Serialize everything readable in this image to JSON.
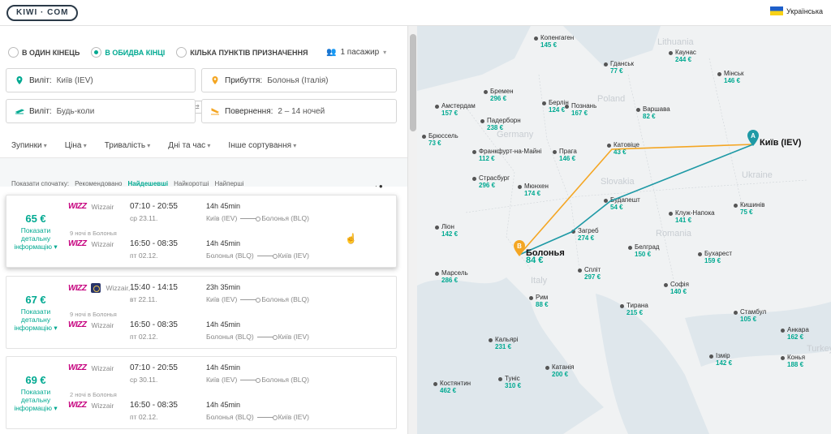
{
  "header": {
    "logo": "KIWI · COM",
    "language": "Українська"
  },
  "trip_type": {
    "one_way": "В ОДИН КІНЕЦЬ",
    "return": "В ОБИДВА КІНЦІ",
    "multi": "КІЛЬКА ПУНКТІВ ПРИЗНАЧЕННЯ",
    "selected": "return"
  },
  "passengers": "1 пасажир",
  "search": {
    "from_label": "Виліт:",
    "from_value": "Київ (IEV)",
    "to_label": "Прибуття:",
    "to_value": "Болонья (Італія)",
    "depart_label": "Виліт:",
    "depart_value": "Будь-коли",
    "return_label": "Повернення:",
    "return_value": "2 – 14 ночей"
  },
  "filters": [
    "Зупинки",
    "Ціна",
    "Тривалість",
    "Дні та час",
    "Інше сортування"
  ],
  "sort": {
    "label": "Показати спочатку:",
    "options": [
      "Рекомендовано",
      "Найдешевші",
      "Найкоротші",
      "Найперші"
    ],
    "active": "Найдешевші"
  },
  "results": [
    {
      "price": "65 €",
      "more": [
        "Показати",
        "детальну",
        "інформацію ▾"
      ],
      "nights": "9 ночі в Болонья",
      "out": {
        "airline": "Wizzair",
        "logo": "WIZZ",
        "times": "07:10 - 20:55",
        "date": "ср 23.11.",
        "duration": "14h 45min",
        "from": "Київ (IEV)",
        "to": "Болонья (BLQ)"
      },
      "back": {
        "airline": "Wizzair",
        "logo": "WIZZ",
        "times": "16:50 - 08:35",
        "date": "пт 02.12.",
        "duration": "14h 45min",
        "from": "Болонья (BLQ)",
        "to": "Київ (IEV)"
      }
    },
    {
      "price": "67 €",
      "more": [
        "Показати",
        "детальну",
        "інформацію ▾"
      ],
      "nights": "9 ночі в Болонья",
      "out": {
        "airline": "Wizzair, ...",
        "logo": "WIZZ",
        "times": "15:40 - 14:15",
        "date": "вт 22.11.",
        "duration": "23h 35min",
        "from": "Київ (IEV)",
        "to": "Болонья (BLQ)"
      },
      "back": {
        "airline": "Wizzair",
        "logo": "WIZZ",
        "times": "16:50 - 08:35",
        "date": "пт 02.12.",
        "duration": "14h 45min",
        "from": "Болонья (BLQ)",
        "to": "Київ (IEV)"
      }
    },
    {
      "price": "69 €",
      "more": [
        "Показати",
        "детальну",
        "інформацію ▾"
      ],
      "nights": "2 ночі в Болонья",
      "out": {
        "airline": "Wizzair",
        "logo": "WIZZ",
        "times": "07:10 - 20:55",
        "date": "ср 30.11.",
        "duration": "14h 45min",
        "from": "Київ (IEV)",
        "to": "Болонья (BLQ)"
      },
      "back": {
        "airline": "Wizzair",
        "logo": "WIZZ",
        "times": "16:50 - 08:35",
        "date": "пт 02.12.",
        "duration": "14h 45min",
        "from": "Болонья (BLQ)",
        "to": "Київ (IEV)"
      }
    }
  ],
  "map": {
    "origin": {
      "name": "Київ (IEV)",
      "marker": "A"
    },
    "destination": {
      "name": "Болонья",
      "price": "84 €",
      "marker": "B"
    },
    "countries": [
      "Lithuania",
      "Poland",
      "Germany",
      "Ukraine",
      "Slovakia",
      "Romania",
      "Italy",
      "Turkey"
    ],
    "cities": [
      {
        "name": "Копенгаген",
        "price": "145 €"
      },
      {
        "name": "Каунас",
        "price": "244 €"
      },
      {
        "name": "Гданськ",
        "price": "77 €"
      },
      {
        "name": "Мінськ",
        "price": "146 €"
      },
      {
        "name": "Бремен",
        "price": "296 €"
      },
      {
        "name": "Амстердам",
        "price": "157 €"
      },
      {
        "name": "Берлін",
        "price": "124 €"
      },
      {
        "name": "Познань",
        "price": "167 €"
      },
      {
        "name": "Варшава",
        "price": "82 €"
      },
      {
        "name": "Падерборн",
        "price": "238 €"
      },
      {
        "name": "Брюссель",
        "price": "73 €"
      },
      {
        "name": "Франкфурт-на-Майні",
        "price": "112 €"
      },
      {
        "name": "Прага",
        "price": "146 €"
      },
      {
        "name": "Катовіце",
        "price": "43 €"
      },
      {
        "name": "Страсбург",
        "price": "296 €"
      },
      {
        "name": "Мюнхен",
        "price": "174 €"
      },
      {
        "name": "Будапешт",
        "price": "54 €"
      },
      {
        "name": "Кишинів",
        "price": "75 €"
      },
      {
        "name": "Ліон",
        "price": "142 €"
      },
      {
        "name": "Клуж-Напока",
        "price": "141 €"
      },
      {
        "name": "Загреб",
        "price": "274 €"
      },
      {
        "name": "Белград",
        "price": "150 €"
      },
      {
        "name": "Бухарест",
        "price": "159 €"
      },
      {
        "name": "Марсель",
        "price": "286 €"
      },
      {
        "name": "Спліт",
        "price": "297 €"
      },
      {
        "name": "Софія",
        "price": "140 €"
      },
      {
        "name": "Рим",
        "price": "88 €"
      },
      {
        "name": "Тирана",
        "price": "215 €"
      },
      {
        "name": "Стамбул",
        "price": "105 €"
      },
      {
        "name": "Анкара",
        "price": "162 €"
      },
      {
        "name": "Кальярі",
        "price": "231 €"
      },
      {
        "name": "Ізмір",
        "price": "142 €"
      },
      {
        "name": "Конья",
        "price": "188 €"
      },
      {
        "name": "Катанія",
        "price": "200 €"
      },
      {
        "name": "Туніс",
        "price": "310 €"
      },
      {
        "name": "Костянтин",
        "price": "462 €"
      }
    ],
    "route_colors": {
      "outbound": "#f4a623",
      "return": "#1f9aa6"
    }
  }
}
